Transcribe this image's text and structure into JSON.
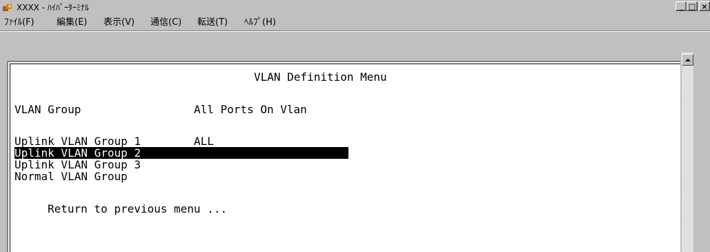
{
  "window": {
    "title": "XXXX - ﾊｲﾊﾟｰﾀｰﾐﾅﾙ",
    "minimize_label": "_",
    "maximize_label": "□",
    "close_label": "×"
  },
  "menubar": {
    "items": [
      {
        "label": "ﾌｧｲﾙ(F)"
      },
      {
        "label": "編集(E)"
      },
      {
        "label": "表示(V)"
      },
      {
        "label": "通信(C)"
      },
      {
        "label": "転送(T)"
      },
      {
        "label": "ﾍﾙﾌﾟ(H)"
      }
    ]
  },
  "terminal": {
    "heading": "VLAN Definition Menu",
    "col_group": "VLAN Group",
    "col_ports": "All Ports On Vlan",
    "rows": [
      {
        "group": "Uplink VLAN Group 1",
        "ports": "ALL"
      },
      {
        "group": "Uplink VLAN Group 2",
        "ports": ""
      },
      {
        "group": "Uplink VLAN Group 3",
        "ports": ""
      },
      {
        "group": "Normal VLAN Group",
        "ports": ""
      }
    ],
    "return_label": "Return to previous menu ..."
  },
  "colors": {
    "chrome": "#c0c0c0",
    "terminal_bg": "#ffffff",
    "highlight_bg": "#000000",
    "highlight_fg": "#ffffff"
  }
}
